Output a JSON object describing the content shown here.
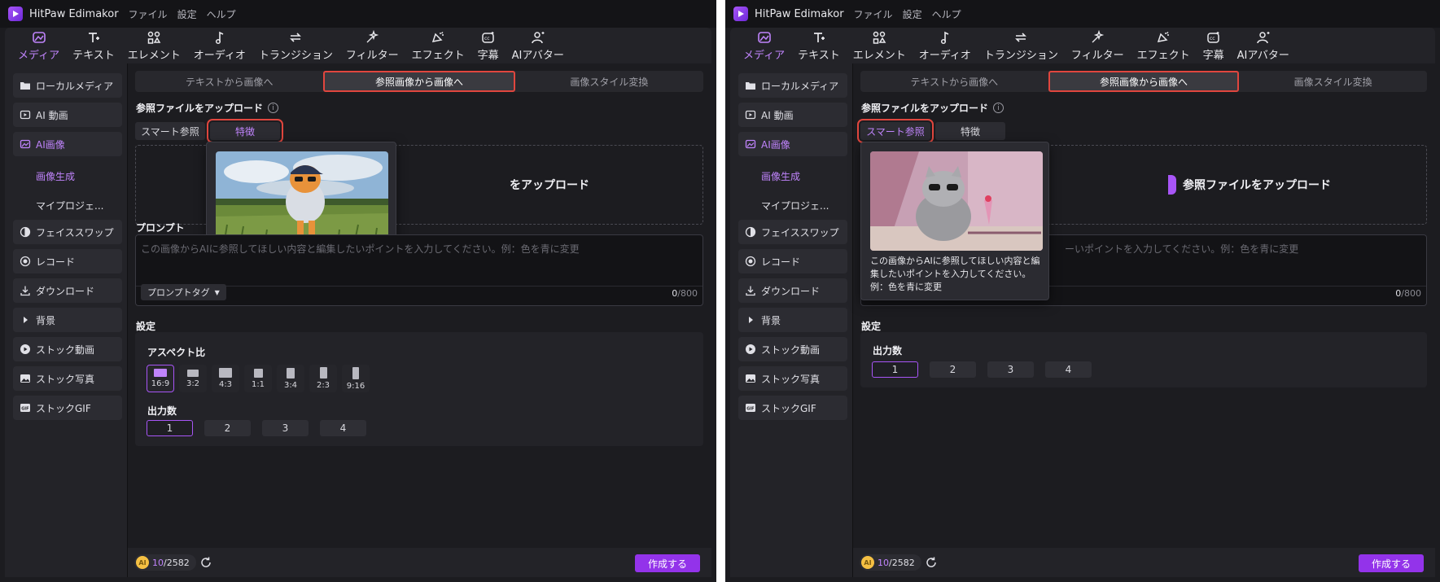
{
  "app": {
    "name": "HitPaw Edimakor",
    "menu": [
      "ファイル",
      "設定",
      "ヘルプ"
    ]
  },
  "toolbar": [
    {
      "label": "メディア",
      "icon": "media-icon"
    },
    {
      "label": "テキスト",
      "icon": "text-icon"
    },
    {
      "label": "エレメント",
      "icon": "elements-icon"
    },
    {
      "label": "オーディオ",
      "icon": "audio-icon"
    },
    {
      "label": "トランジション",
      "icon": "transition-icon"
    },
    {
      "label": "フィルター",
      "icon": "filter-icon"
    },
    {
      "label": "エフェクト",
      "icon": "effect-icon"
    },
    {
      "label": "字幕",
      "icon": "subtitle-icon"
    },
    {
      "label": "AIアバター",
      "icon": "avatar-icon"
    }
  ],
  "sidebar": {
    "items": [
      {
        "label": "ローカルメディア",
        "icon": "folder-icon"
      },
      {
        "label": "AI 動画",
        "icon": "ai-video-icon"
      },
      {
        "label": "AI画像",
        "icon": "ai-image-icon"
      },
      {
        "label": "フェイススワップ",
        "icon": "face-swap-icon"
      },
      {
        "label": "レコード",
        "icon": "record-icon"
      },
      {
        "label": "ダウンロード",
        "icon": "download-icon"
      },
      {
        "label": "背景",
        "icon": "triangle-right-icon"
      },
      {
        "label": "ストック動画",
        "icon": "play-icon"
      },
      {
        "label": "ストック写真",
        "icon": "photo-icon"
      },
      {
        "label": "ストックGIF",
        "icon": "gif-icon"
      }
    ],
    "sub_items": [
      "画像生成",
      "マイプロジェ..."
    ]
  },
  "tabs": [
    "テキストから画像へ",
    "参照画像から画像へ",
    "画像スタイル変換"
  ],
  "upload": {
    "section_label": "参照ファイルをアップロード",
    "info_icon": "i",
    "modes": [
      "スマート参照",
      "特徴"
    ],
    "button_label": "参照ファイルをアップロード",
    "left_partial_label": "をアップロード"
  },
  "prompt": {
    "label": "プロンプト",
    "placeholder": "この画像からAIに参照してほしい内容と編集したいポイントを入力してください。例：色を青に変更",
    "right_partial_placeholder": "ーいポイントを入力してください。例：色を青に変更",
    "tag_button": "プロンプトタグ",
    "count_current": "0",
    "count_max": "/800"
  },
  "settings": {
    "label": "設定",
    "aspect_label": "アスペクト比",
    "aspects": [
      "16:9",
      "3:2",
      "4:3",
      "1:1",
      "3:4",
      "2:3",
      "9:16"
    ],
    "output_label": "出力数",
    "outputs": [
      "1",
      "2",
      "3",
      "4"
    ]
  },
  "footer": {
    "coin_label": "AI",
    "credits_used": "10",
    "credits_total": "/2582",
    "create_button": "作成する"
  },
  "popover_right": {
    "description": "この画像からAIに参照してほしい内容と編集したいポイントを入力してください。例：色を青に変更"
  },
  "colors": {
    "accent": "#a855f7",
    "highlight_box": "#e0463e",
    "background": "#1c1c20"
  }
}
